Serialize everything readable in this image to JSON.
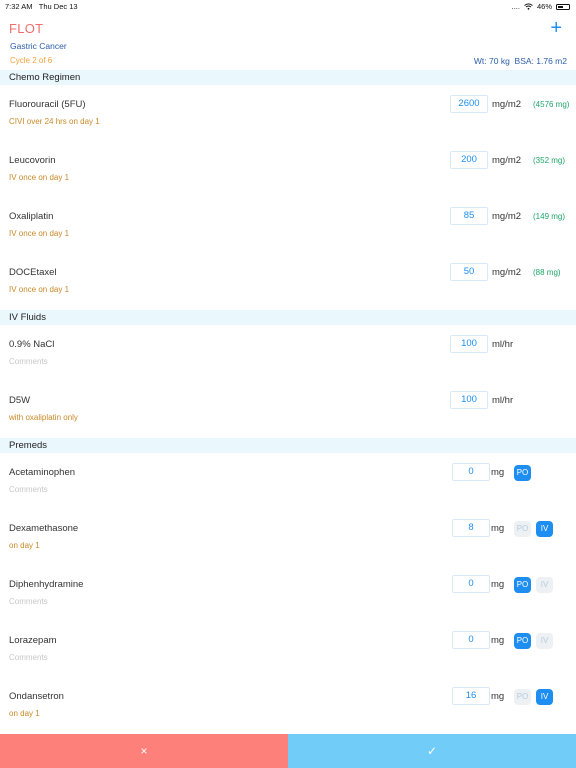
{
  "status_bar": {
    "time": "7:32 AM",
    "date": "Thu Dec 13",
    "signal": "....",
    "battery": "46%",
    "battery_level": 0.46
  },
  "header": {
    "title": "FLOT",
    "subtitle": "Gastric Cancer",
    "cycle": "Cycle 2 of 6",
    "add_label": "+",
    "weight": "Wt: 70 kg",
    "bsa": "BSA: 1.76 m2"
  },
  "sections": {
    "chemo": "Chemo Regimen",
    "fluids": "IV Fluids",
    "premeds": "Premeds"
  },
  "chemo": [
    {
      "name": "Fluorouracil (5FU)",
      "note": "CIVI over 24 hrs on day 1",
      "dose": "2600",
      "unit": "mg/m2",
      "calc": "(4576 mg)"
    },
    {
      "name": "Leucovorin",
      "note": "IV once on day 1",
      "dose": "200",
      "unit": "mg/m2",
      "calc": "(352 mg)"
    },
    {
      "name": "Oxaliplatin",
      "note": "IV once on day 1",
      "dose": "85",
      "unit": "mg/m2",
      "calc": "(149 mg)"
    },
    {
      "name": "DOCEtaxel",
      "note": "IV once on day 1",
      "dose": "50",
      "unit": "mg/m2",
      "calc": "(88 mg)"
    }
  ],
  "fluids": [
    {
      "name": "0.9% NaCl",
      "note": "Comments",
      "dose": "100",
      "unit": "ml/hr"
    },
    {
      "name": "D5W",
      "note": "with oxaliplatin only",
      "dose": "100",
      "unit": "ml/hr"
    }
  ],
  "premeds": [
    {
      "name": "Acetaminophen",
      "note": "Comments",
      "dose": "0",
      "unit": "mg",
      "po": "PO",
      "iv": ""
    },
    {
      "name": "Dexamethasone",
      "note": "on day 1",
      "dose": "8",
      "unit": "mg",
      "po": "PO",
      "iv": "IV"
    },
    {
      "name": "Diphenhydramine",
      "note": "Comments",
      "dose": "0",
      "unit": "mg",
      "po": "PO",
      "iv": "IV"
    },
    {
      "name": "Lorazepam",
      "note": "Comments",
      "dose": "0",
      "unit": "mg",
      "po": "PO",
      "iv": "IV"
    },
    {
      "name": "Ondansetron",
      "note": "on day 1",
      "dose": "16",
      "unit": "mg",
      "po": "PO",
      "iv": "IV"
    }
  ],
  "footer": {
    "cancel": "×",
    "confirm": "✓"
  },
  "colors": {
    "accent": "#1e8ef0",
    "title": "#f06d6d",
    "cancel": "#fd807b",
    "confirm": "#72ccf8",
    "section": "#eaf7fd"
  }
}
